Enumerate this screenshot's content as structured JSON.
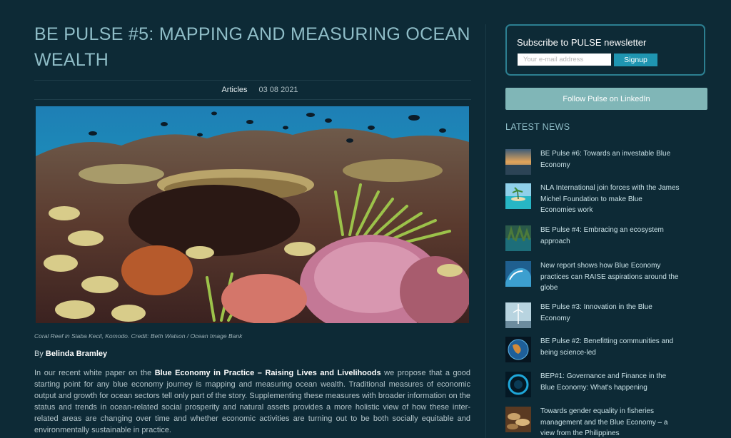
{
  "article": {
    "title": "BE PULSE #5: MAPPING AND MEASURING OCEAN WEALTH",
    "category": "Articles",
    "date": "03 08 2021",
    "image_caption": "Coral Reef in Siaba Kecil, Komodo. Credit: Beth Watson / Ocean Image Bank",
    "byline_prefix": "By",
    "author": "Belinda Bramley",
    "body_intro": "In our recent white paper on the",
    "body_link": "Blue Economy in Practice – Raising Lives and Livelihoods",
    "body_rest": "we propose that a good starting point for any blue economy journey is mapping and measuring ocean wealth. Traditional measures of economic output and growth for ocean sectors tell only part of the story. Supplementing these measures with broader information on the status and trends in ocean-related social prosperity and natural assets provides a more holistic view of how these inter-related areas are changing over time and whether economic activities are turning out to be both socially equitable and environmentally sustainable in practice."
  },
  "sidebar": {
    "newsletter": {
      "title": "Subscribe to PULSE newsletter",
      "email_placeholder": "Your e-mail address",
      "signup_label": "Signup"
    },
    "linkedin_label": "Follow Pulse on LinkedIn",
    "latest_news_heading": "LATEST NEWS",
    "news": [
      {
        "title": "BE Pulse #6: Towards an investable Blue Economy",
        "thumb": "sunset-sea-thumb"
      },
      {
        "title": "NLA International join forces with the James Michel Foundation to make Blue Economies work",
        "thumb": "tropical-island-thumb"
      },
      {
        "title": "BE Pulse #4: Embracing an ecosystem approach",
        "thumb": "mangrove-thumb"
      },
      {
        "title": "New report shows how Blue Economy practices can RAISE aspirations around the globe",
        "thumb": "wave-thumb"
      },
      {
        "title": "BE Pulse #3: Innovation in the Blue Economy",
        "thumb": "wind-turbine-thumb"
      },
      {
        "title": "BE Pulse #2: Benefitting communities and being science-led",
        "thumb": "globe-thumb"
      },
      {
        "title": "BEP#1: Governance and Finance in the Blue Economy: What's happening",
        "thumb": "circle-logo-thumb"
      },
      {
        "title": "Towards gender equality in fisheries management and the Blue Economy – a view from the Philippines",
        "thumb": "fish-market-thumb"
      }
    ]
  }
}
